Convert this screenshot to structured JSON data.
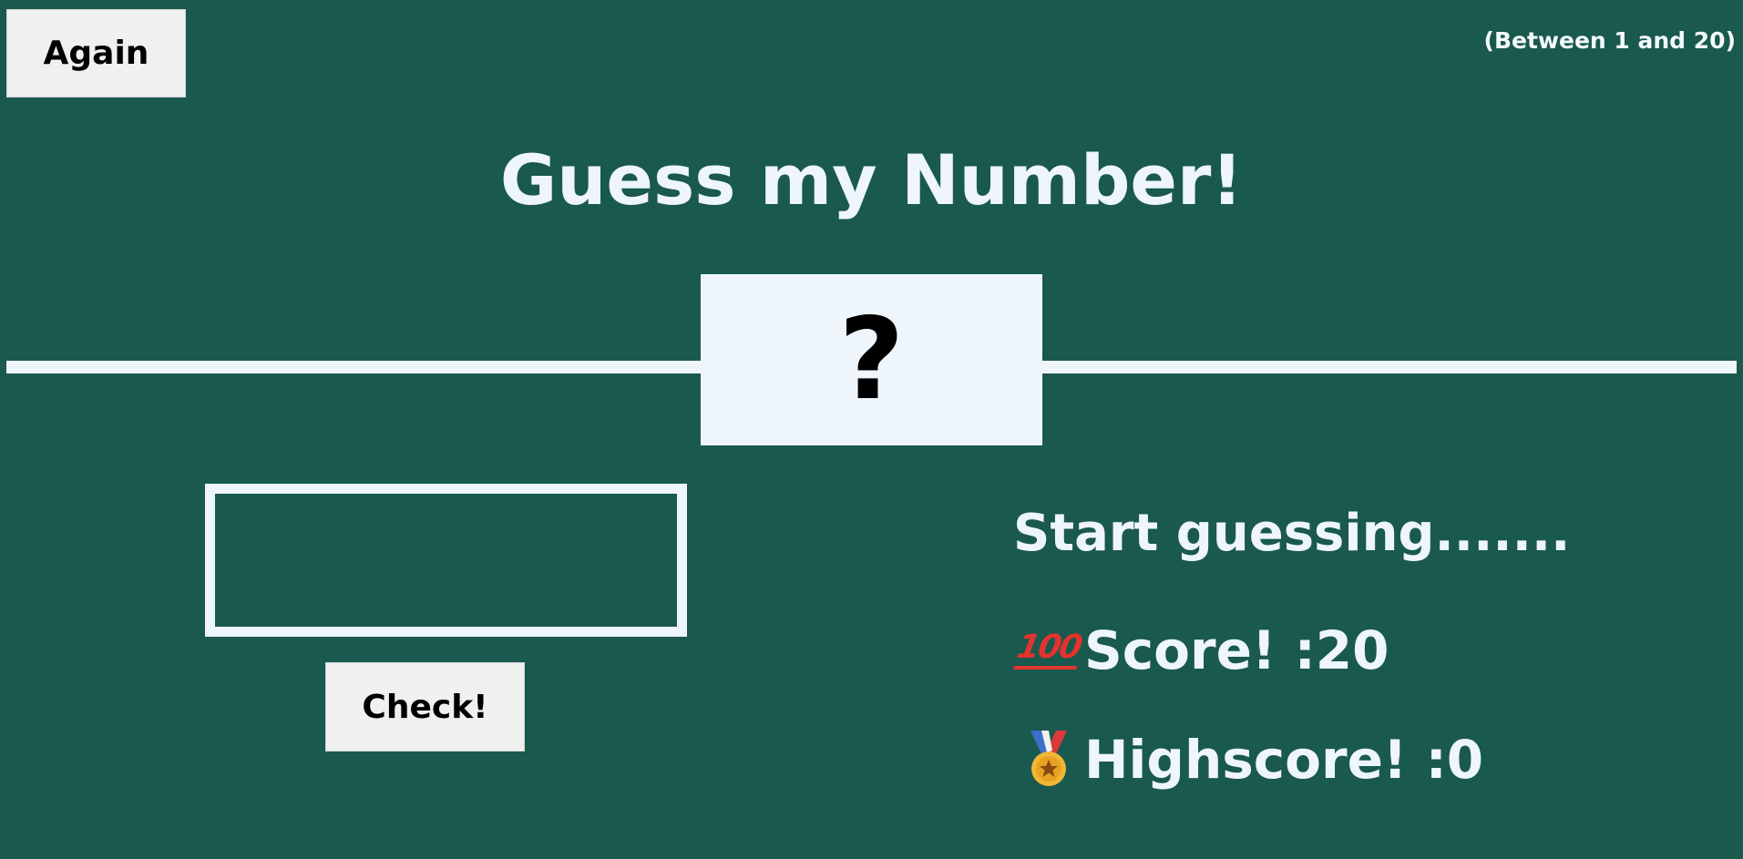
{
  "header": {
    "again_label": "Again",
    "range_hint": "(Between 1 and 20)"
  },
  "title": "Guess my Number!",
  "secret": {
    "value": "?"
  },
  "guess": {
    "value": "",
    "placeholder": ""
  },
  "check_label": "Check!",
  "status": {
    "message": "Start guessing.......",
    "score_label": "Score! : ",
    "score_value": "20",
    "score_icon": "hundred-points-icon",
    "highscore_label": "Highscore! : ",
    "highscore_value": "0",
    "highscore_icon": "medal-icon"
  },
  "colors": {
    "background": "#1a594d",
    "foreground": "#eef6fb",
    "button_bg": "#f0f0f0",
    "hundred_red": "#e2332f",
    "medal_gold": "#f2b636"
  }
}
